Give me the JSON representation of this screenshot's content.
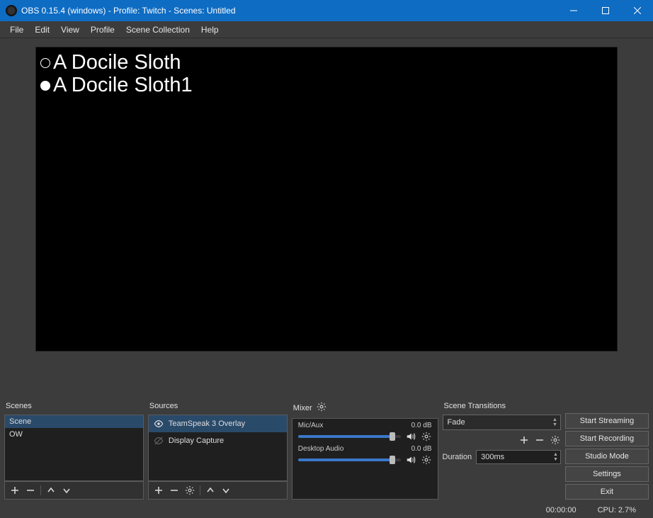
{
  "titlebar": {
    "title": "OBS 0.15.4 (windows) - Profile: Twitch - Scenes: Untitled"
  },
  "menubar": {
    "file": "File",
    "edit": "Edit",
    "view": "View",
    "profile": "Profile",
    "scene_collection": "Scene Collection",
    "help": "Help"
  },
  "preview": {
    "line1": "A Docile Sloth",
    "line2": "A Docile Sloth1"
  },
  "panels": {
    "scenes": {
      "title": "Scenes",
      "items": [
        "Scene",
        "OW"
      ]
    },
    "sources": {
      "title": "Sources",
      "items": [
        {
          "name": "TeamSpeak 3 Overlay",
          "visible": true,
          "selected": true
        },
        {
          "name": "Display Capture",
          "visible": false,
          "selected": false
        }
      ]
    },
    "mixer": {
      "title": "Mixer",
      "channels": [
        {
          "name": "Mic/Aux",
          "level": "0.0 dB"
        },
        {
          "name": "Desktop Audio",
          "level": "0.0 dB"
        }
      ]
    },
    "transitions": {
      "title": "Scene Transitions",
      "selected": "Fade",
      "duration_label": "Duration",
      "duration_value": "300ms"
    }
  },
  "controls": {
    "start_streaming": "Start Streaming",
    "start_recording": "Start Recording",
    "studio_mode": "Studio Mode",
    "settings": "Settings",
    "exit": "Exit"
  },
  "statusbar": {
    "time": "00:00:00",
    "cpu": "CPU: 2.7%"
  }
}
